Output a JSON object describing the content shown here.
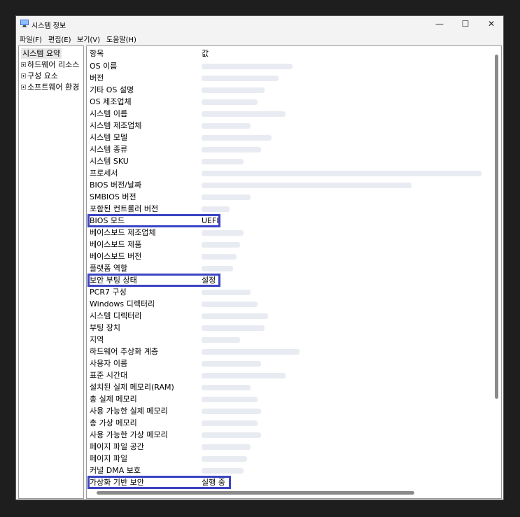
{
  "window": {
    "title": "시스템 정보",
    "controls": {
      "minimize": "—",
      "maximize": "☐",
      "close": "✕"
    }
  },
  "menu": [
    {
      "label": "파일(F)"
    },
    {
      "label": "편집(E)"
    },
    {
      "label": "보기(V)"
    },
    {
      "label": "도움말(H)"
    }
  ],
  "tree": {
    "root": "시스템 요약",
    "children": [
      "하드웨어 리소스",
      "구성 요소",
      "소프트웨어 환경"
    ]
  },
  "table": {
    "headers": {
      "item": "항목",
      "value": "값"
    },
    "rows": [
      {
        "name": "OS 이름",
        "value": ""
      },
      {
        "name": "버전",
        "value": ""
      },
      {
        "name": "기타 OS 설명",
        "value": ""
      },
      {
        "name": "OS 제조업체",
        "value": ""
      },
      {
        "name": "시스템 이름",
        "value": ""
      },
      {
        "name": "시스템 제조업체",
        "value": ""
      },
      {
        "name": "시스템 모델",
        "value": ""
      },
      {
        "name": "시스템 종류",
        "value": ""
      },
      {
        "name": "시스템 SKU",
        "value": ""
      },
      {
        "name": "프로세서",
        "value": ""
      },
      {
        "name": "BIOS 버전/날짜",
        "value": ""
      },
      {
        "name": "SMBIOS 버전",
        "value": ""
      },
      {
        "name": "포함된 컨트롤러 버전",
        "value": ""
      },
      {
        "name": "BIOS 모드",
        "value": "UEFI"
      },
      {
        "name": "베이스보드 제조업체",
        "value": ""
      },
      {
        "name": "베이스보드 제품",
        "value": ""
      },
      {
        "name": "베이스보드 버전",
        "value": ""
      },
      {
        "name": "플랫폼 역할",
        "value": ""
      },
      {
        "name": "보안 부팅 상태",
        "value": "설정"
      },
      {
        "name": "PCR7 구성",
        "value": ""
      },
      {
        "name": "Windows 디렉터리",
        "value": ""
      },
      {
        "name": "시스템 디렉터리",
        "value": ""
      },
      {
        "name": "부팅 장치",
        "value": ""
      },
      {
        "name": "지역",
        "value": ""
      },
      {
        "name": "하드웨어 추상화 계층",
        "value": ""
      },
      {
        "name": "사용자 이름",
        "value": ""
      },
      {
        "name": "표준 시간대",
        "value": ""
      },
      {
        "name": "설치된 실제 메모리(RAM)",
        "value": ""
      },
      {
        "name": "총 실제 메모리",
        "value": ""
      },
      {
        "name": "사용 가능한 실제 메모리",
        "value": ""
      },
      {
        "name": "총 가상 메모리",
        "value": ""
      },
      {
        "name": "사용 가능한 가상 메모리",
        "value": ""
      },
      {
        "name": "페이지 파일 공간",
        "value": ""
      },
      {
        "name": "페이지 파일",
        "value": ""
      },
      {
        "name": "커널 DMA 보호",
        "value": ""
      },
      {
        "name": "가상화 기반 보안",
        "value": "실행 중"
      }
    ]
  },
  "highlights": [
    "BIOS 모드",
    "보안 부팅 상태",
    "가상화 기반 보안"
  ],
  "colors": {
    "highlight_border": "#3a44c4",
    "window_bg": "#f3f3f3",
    "backdrop": "#1e1e1e"
  },
  "icons": {
    "app": "system-info-icon",
    "expander": "plus-box-icon"
  }
}
